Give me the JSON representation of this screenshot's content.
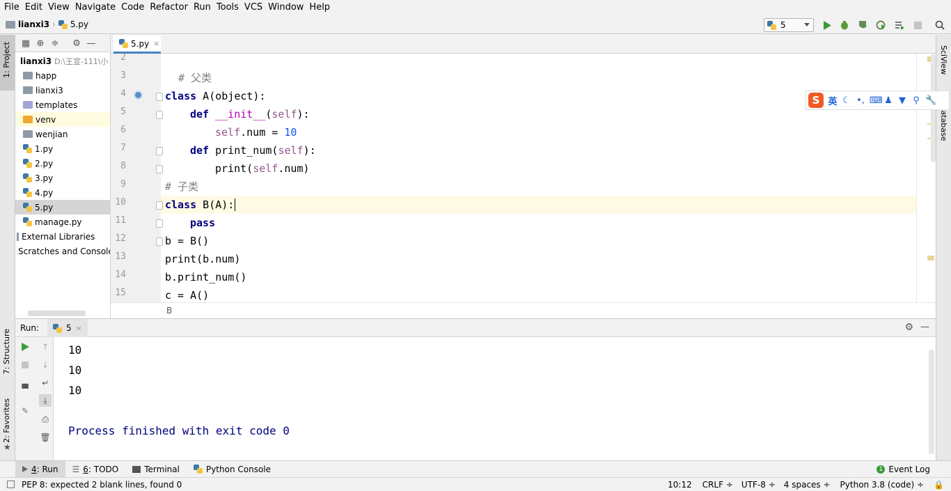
{
  "menu": [
    "File",
    "Edit",
    "View",
    "Navigate",
    "Code",
    "Refactor",
    "Run",
    "Tools",
    "VCS",
    "Window",
    "Help"
  ],
  "breadcrumb": {
    "project": "lianxi3",
    "file": "5.py"
  },
  "run_config": "5",
  "left_strip": {
    "project": "1: Project",
    "structure": "7: Structure",
    "favorites": "2: Favorites"
  },
  "right_strip": {
    "sciview": "SciView",
    "database": "Database"
  },
  "project": {
    "root_name": "lianxi3",
    "root_path": "D:\\王宣-111\\小",
    "items": [
      {
        "label": "happ",
        "type": "folder"
      },
      {
        "label": "lianxi3",
        "type": "folder"
      },
      {
        "label": "templates",
        "type": "folder-purple"
      },
      {
        "label": "venv",
        "type": "folder-yellow"
      },
      {
        "label": "wenjian",
        "type": "folder"
      },
      {
        "label": "1.py",
        "type": "py"
      },
      {
        "label": "2.py",
        "type": "py"
      },
      {
        "label": "3.py",
        "type": "py"
      },
      {
        "label": "4.py",
        "type": "py"
      },
      {
        "label": "5.py",
        "type": "py"
      },
      {
        "label": "manage.py",
        "type": "py"
      }
    ],
    "external": "External Libraries",
    "scratches": "Scratches and Consoles"
  },
  "editor": {
    "tab": "5.py",
    "line_numbers": [
      "2",
      "3",
      "4",
      "5",
      "6",
      "7",
      "8",
      "9",
      "10",
      "11",
      "12",
      "13",
      "14",
      "15"
    ],
    "code": {
      "l3": "# 父类",
      "l4a": "class",
      "l4b": " A(object):",
      "l5a": "def",
      "l5b": "__init__",
      "l5c": "(",
      "l5d": "self",
      "l5e": "):",
      "l6a": "self",
      "l6b": ".num = ",
      "l6c": "10",
      "l7a": "def",
      "l7b": " print_num(",
      "l7c": "self",
      "l7d": "):",
      "l8a": "print(",
      "l8b": "self",
      "l8c": ".num)",
      "l9": "# 子类",
      "l10a": "class",
      "l10b": " B(A):",
      "l11": "pass",
      "l12": "b = B()",
      "l13": "print(b.num)",
      "l14": "b.print_num()",
      "l15": "c = A()"
    },
    "breadcrumb": "B"
  },
  "run": {
    "label": "Run:",
    "tab": "5",
    "output": [
      "10",
      "10",
      "10",
      "",
      "Process finished with exit code 0"
    ]
  },
  "bottom_tabs": [
    {
      "num": "4",
      "label": ": Run"
    },
    {
      "num": "6",
      "label": ": TODO"
    },
    {
      "num": "",
      "label": "Terminal"
    },
    {
      "num": "",
      "label": "Python Console"
    }
  ],
  "event_log": "Event Log",
  "status": {
    "message": "PEP 8: expected 2 blank lines, found 0",
    "position": "10:12",
    "line_sep": "CRLF",
    "encoding": "UTF-8",
    "indent": "4 spaces",
    "interpreter": "Python 3.8 (code)"
  },
  "ime": {
    "lang": "英"
  },
  "colors": {
    "keyword": "#000080",
    "comment": "#808080",
    "self": "#94558d",
    "number": "#1750eb",
    "magic": "#b200b2",
    "accent": "#4083c9",
    "run_green": "#3a9c3a"
  }
}
